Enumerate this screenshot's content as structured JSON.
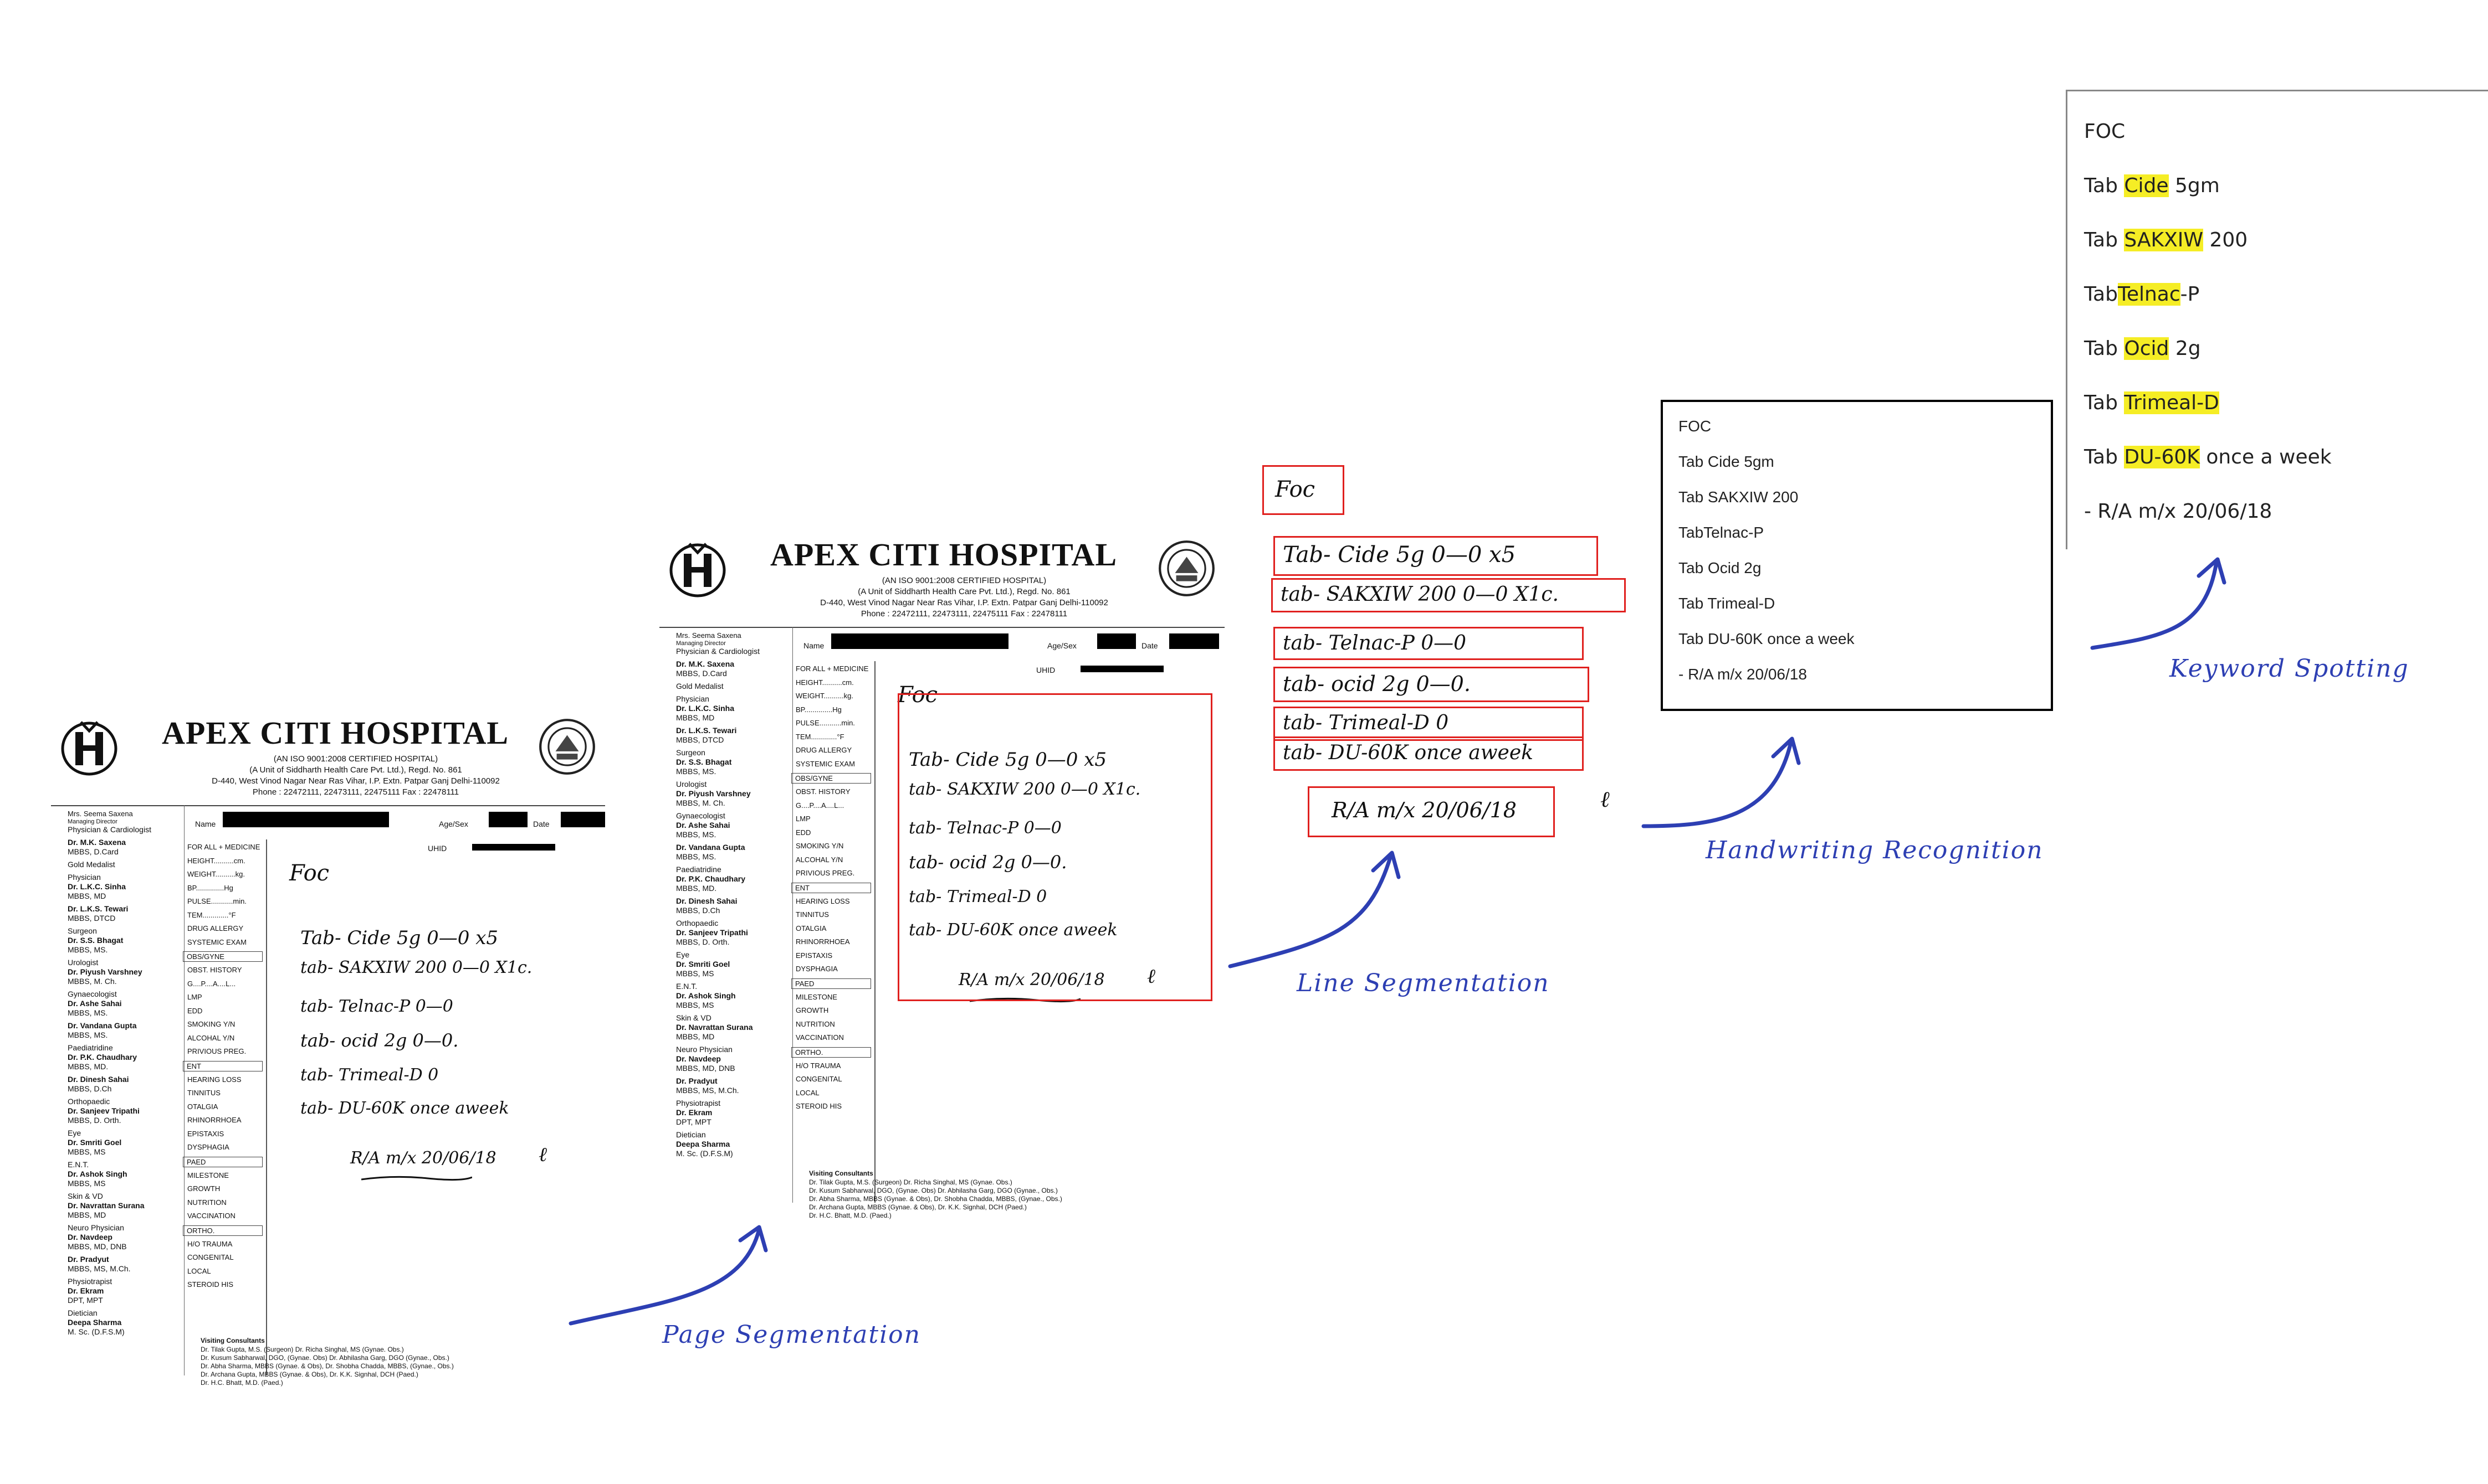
{
  "hospital": {
    "name": "APEX CITI HOSPITAL",
    "cert": "(AN ISO 9001:2008 CERTIFIED HOSPITAL)",
    "unit": "(A Unit of Siddharth Health Care Pvt. Ltd.), Regd. No. 861",
    "address": "D-440, West Vinod Nagar Near Ras Vihar, I.P. Extn. Patpar Ganj Delhi-110092",
    "phone": "Phone : 22472111, 22473111, 22475111 Fax : 22478111",
    "director": "Mrs. Seema Saxena",
    "director_title": "Managing Director",
    "name_label": "Name",
    "age_label": "Age/Sex",
    "date_label": "Date",
    "uhid_label": "UHID"
  },
  "doctors": [
    {
      "dept": "Physician & Cardiologist",
      "name": "",
      "qual": ""
    },
    {
      "dept": "",
      "name": "Dr. M.K. Saxena",
      "qual": "MBBS, D.Card"
    },
    {
      "dept": "",
      "name": "",
      "qual": "Gold Medalist"
    },
    {
      "dept": "Physician",
      "name": "Dr. L.K.C. Sinha",
      "qual": "MBBS, MD"
    },
    {
      "dept": "",
      "name": "Dr. L.K.S. Tewari",
      "qual": "MBBS, DTCD"
    },
    {
      "dept": "Surgeon",
      "name": "Dr. S.S. Bhagat",
      "qual": "MBBS, MS."
    },
    {
      "dept": "Urologist",
      "name": "Dr. Piyush Varshney",
      "qual": "MBBS, M. Ch."
    },
    {
      "dept": "Gynaecologist",
      "name": "Dr. Ashe Sahai",
      "qual": "MBBS, MS."
    },
    {
      "dept": "",
      "name": "Dr. Vandana Gupta",
      "qual": "MBBS, MS."
    },
    {
      "dept": "Paediatridine",
      "name": "Dr. P.K. Chaudhary",
      "qual": "MBBS, MD."
    },
    {
      "dept": "",
      "name": "Dr. Dinesh Sahai",
      "qual": "MBBS, D.Ch"
    },
    {
      "dept": "Orthopaedic",
      "name": "Dr. Sanjeev Tripathi",
      "qual": "MBBS, D. Orth."
    },
    {
      "dept": "Eye",
      "name": "Dr. Smriti Goel",
      "qual": "MBBS, MS"
    },
    {
      "dept": "E.N.T.",
      "name": "Dr. Ashok Singh",
      "qual": "MBBS, MS"
    },
    {
      "dept": "Skin & VD",
      "name": "Dr. Navrattan Surana",
      "qual": "MBBS, MD"
    },
    {
      "dept": "Neuro Physician",
      "name": "Dr. Navdeep",
      "qual": "MBBS, MD, DNB"
    },
    {
      "dept": "",
      "name": "Dr. Pradyut",
      "qual": "MBBS, MS, M.Ch."
    },
    {
      "dept": "Physiotrapist",
      "name": "Dr. Ekram",
      "qual": "DPT, MPT"
    },
    {
      "dept": "Dietician",
      "name": "Deepa Sharma",
      "qual": "M. Sc. (D.F.S.M)"
    }
  ],
  "medicine_panel": [
    {
      "label": "FOR ALL + MEDICINE",
      "box": false
    },
    {
      "label": "HEIGHT..........cm.",
      "box": false
    },
    {
      "label": "WEIGHT..........kg.",
      "box": false
    },
    {
      "label": "BP..............Hg",
      "box": false
    },
    {
      "label": "PULSE...........min.",
      "box": false
    },
    {
      "label": "TEM.............°F",
      "box": false
    },
    {
      "label": "DRUG ALLERGY",
      "box": false
    },
    {
      "label": "SYSTEMIC EXAM",
      "box": false
    },
    {
      "label": "OBS/GYNE",
      "box": true
    },
    {
      "label": "OBST. HISTORY",
      "box": false
    },
    {
      "label": "G....P....A....L...",
      "box": false
    },
    {
      "label": "LMP",
      "box": false
    },
    {
      "label": "EDD",
      "box": false
    },
    {
      "label": "SMOKING    Y/N",
      "box": false
    },
    {
      "label": "ALCOHAL    Y/N",
      "box": false
    },
    {
      "label": "PRIVIOUS PREG.",
      "box": false
    },
    {
      "label": "ENT",
      "box": true
    },
    {
      "label": "HEARING LOSS",
      "box": false
    },
    {
      "label": "TINNITUS",
      "box": false
    },
    {
      "label": "OTALGIA",
      "box": false
    },
    {
      "label": "RHINORRHOEA",
      "box": false
    },
    {
      "label": "EPISTAXIS",
      "box": false
    },
    {
      "label": "DYSPHAGIA",
      "box": false
    },
    {
      "label": "PAED",
      "box": true
    },
    {
      "label": "MILESTONE",
      "box": false
    },
    {
      "label": "GROWTH",
      "box": false
    },
    {
      "label": "NUTRITION",
      "box": false
    },
    {
      "label": "VACCINATION",
      "box": false
    },
    {
      "label": "ORTHO.",
      "box": true
    },
    {
      "label": "H/O TRAUMA",
      "box": false
    },
    {
      "label": "CONGENITAL",
      "box": false
    },
    {
      "label": "LOCAL",
      "box": false
    },
    {
      "label": "STEROID HIS",
      "box": false
    }
  ],
  "visiting": {
    "title": "Visiting Consultants",
    "lines": [
      "Dr. Tilak Gupta, M.S. (Surgeon) Dr. Richa Singhal, MS (Gynae. Obs.)",
      "Dr. Kusum Sabharwal, DGO, (Gynae. Obs) Dr. Abhilasha Garg, DGO (Gynae., Obs.)",
      "Dr. Abha Sharma, MBBS (Gynae. & Obs), Dr. Shobha Chadda, MBBS, (Gynae., Obs.)",
      "Dr. Archana Gupta, MBBS (Gynae. & Obs), Dr. K.K. Signhal, DCH (Paed.)",
      "Dr. H.C. Bhatt, M.D. (Paed.)"
    ]
  },
  "handwriting": [
    "Foc",
    "Tab- Cide 5g  0—0 x5",
    "tab- SAKXIW 200 0—0 X1c.",
    "tab- Telnac-P  0—0",
    "tab- ocid 2g   0—0.",
    "tab- Trimeal-D  0",
    "tab- DU-60K once aweek",
    "R/A m/x 20/06/18"
  ],
  "recognized_lines": [
    "FOC",
    "Tab Cide 5gm",
    "Tab SAKXIW 200",
    "TabTelnac-P",
    "Tab Ocid 2g",
    "Tab Trimeal-D",
    "Tab DU-60K once a week",
    "- R/A m/x 20/06/18"
  ],
  "keyword_lines": [
    {
      "pre": "FOC",
      "kw": "",
      "post": ""
    },
    {
      "pre": "Tab ",
      "kw": "Cide",
      "post": " 5gm"
    },
    {
      "pre": "Tab ",
      "kw": "SAKXIW",
      "post": " 200"
    },
    {
      "pre": "Tab",
      "kw": "Telnac",
      "post": "-P"
    },
    {
      "pre": "Tab ",
      "kw": "Ocid",
      "post": " 2g"
    },
    {
      "pre": "Tab ",
      "kw": "Trimeal-D",
      "post": ""
    },
    {
      "pre": "Tab ",
      "kw": "DU-60K",
      "post": " once a week"
    },
    {
      "pre": "- R/A m/x 20/06/18",
      "kw": "",
      "post": ""
    }
  ],
  "captions": {
    "page": "Page Segmentation",
    "line": "Line Segmentation",
    "hwr": "Handwriting Recognition",
    "kws": "Keyword Spotting"
  },
  "colors": {
    "arrow": "#2d3fb3",
    "segment_box": "#e0201e",
    "highlight": "#f5ed25"
  }
}
